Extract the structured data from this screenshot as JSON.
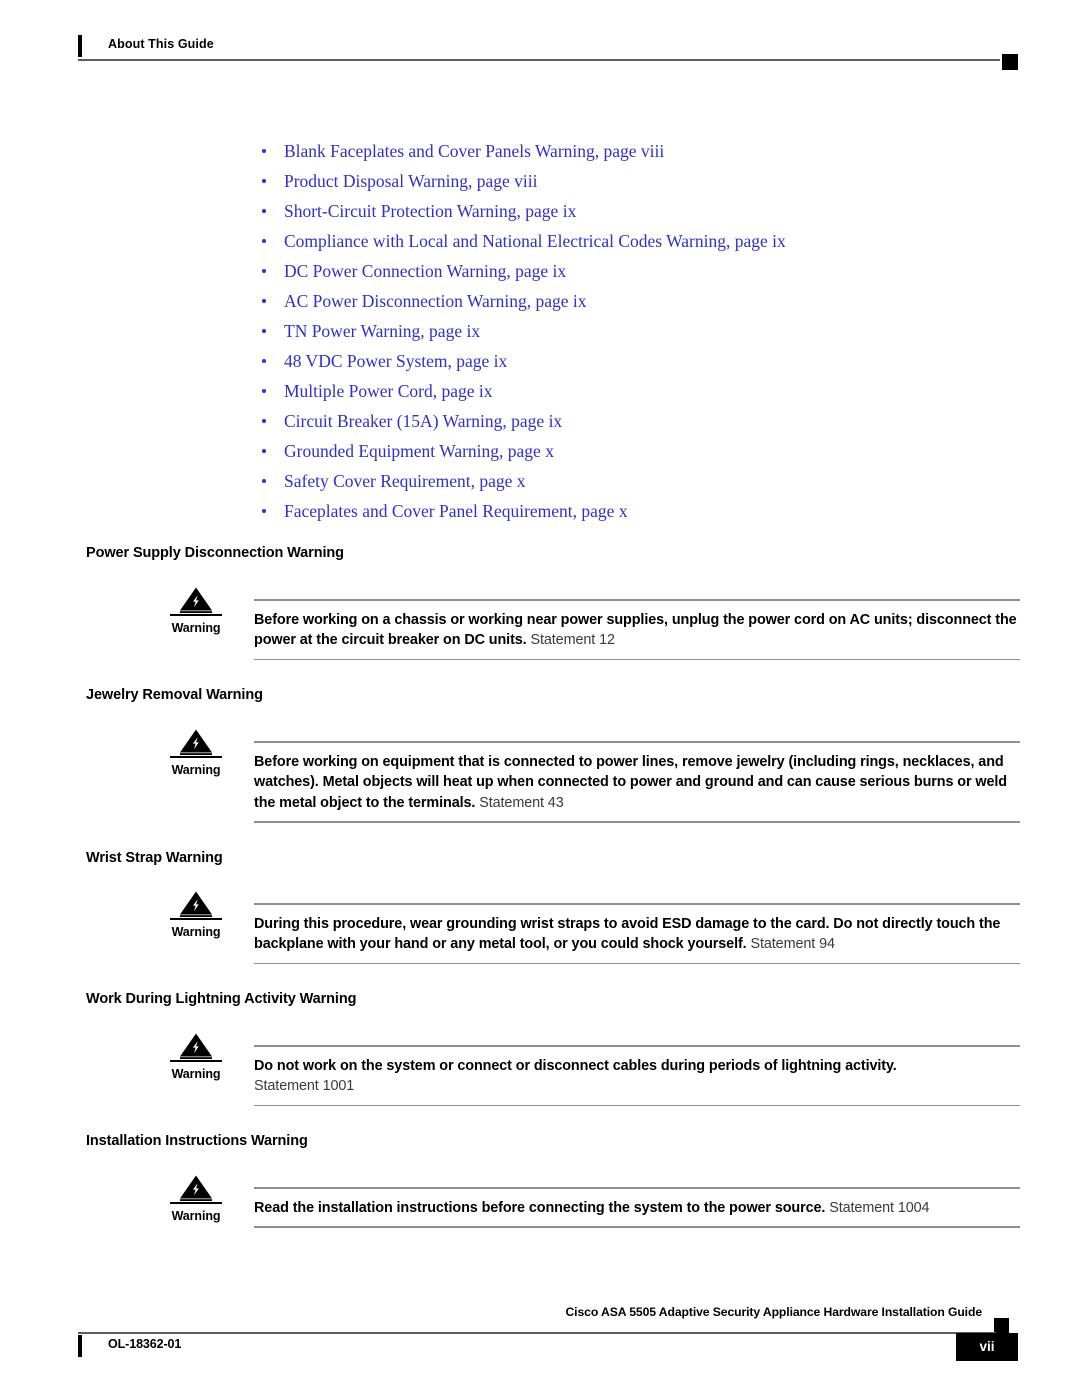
{
  "header": {
    "title": "About This Guide"
  },
  "link_list": [
    {
      "label": "Blank Faceplates and Cover Panels Warning, page viii"
    },
    {
      "label": "Product Disposal Warning, page viii"
    },
    {
      "label": "Short-Circuit Protection Warning, page ix"
    },
    {
      "label": "Compliance with Local and National Electrical Codes Warning, page ix"
    },
    {
      "label": "DC Power Connection Warning, page ix"
    },
    {
      "label": "AC Power Disconnection Warning, page ix"
    },
    {
      "label": "TN Power Warning, page ix"
    },
    {
      "label": "48 VDC Power System, page ix"
    },
    {
      "label": "Multiple Power Cord, page ix"
    },
    {
      "label": "Circuit Breaker (15A) Warning, page ix"
    },
    {
      "label": "Grounded Equipment Warning, page x"
    },
    {
      "label": "Safety Cover Requirement, page x"
    },
    {
      "label": "Faceplates and Cover Panel Requirement, page x"
    }
  ],
  "sections": [
    {
      "heading": "Power Supply Disconnection Warning",
      "warning_label": "Warning",
      "icon": "warning-lightning-triangle-icon",
      "body": "Before working on a chassis or working near power supplies, unplug the power cord on AC units; disconnect the power at the circuit breaker on DC units.",
      "statement": "Statement 12",
      "statement_on_new_line": false
    },
    {
      "heading": "Jewelry Removal Warning",
      "warning_label": "Warning",
      "icon": "warning-lightning-triangle-icon",
      "body": "Before working on equipment that is connected to power lines, remove jewelry (including rings, necklaces, and watches). Metal objects will heat up when connected to power and ground and can cause serious burns or weld the metal object to the terminals.",
      "statement": "Statement 43",
      "statement_on_new_line": false
    },
    {
      "heading": "Wrist Strap Warning",
      "warning_label": "Warning",
      "icon": "warning-lightning-triangle-icon",
      "body": "During this procedure, wear grounding wrist straps to avoid ESD damage to the card. Do not directly touch the backplane with your hand or any metal tool, or you could shock yourself.",
      "statement": "Statement 94",
      "statement_on_new_line": false
    },
    {
      "heading": "Work During Lightning Activity Warning",
      "warning_label": "Warning",
      "icon": "warning-lightning-triangle-icon",
      "body": "Do not work on the system or connect or disconnect cables during periods of lightning activity.",
      "statement": "Statement 1001",
      "statement_on_new_line": true
    },
    {
      "heading": "Installation Instructions Warning",
      "warning_label": "Warning",
      "icon": "warning-lightning-triangle-icon",
      "body": "Read the installation instructions before connecting the system to the power source.",
      "statement": "Statement 1004",
      "statement_on_new_line": false
    }
  ],
  "footer": {
    "guide_title": "Cisco ASA 5505 Adaptive Security Appliance Hardware Installation Guide",
    "doc_id": "OL-18362-01",
    "page_number": "vii"
  },
  "colors": {
    "link": "#2f2fcf",
    "rule": "#8e8e8e",
    "header_rule": "#5d5d5d",
    "text": "#000000",
    "statement": "#3a3a3a"
  }
}
